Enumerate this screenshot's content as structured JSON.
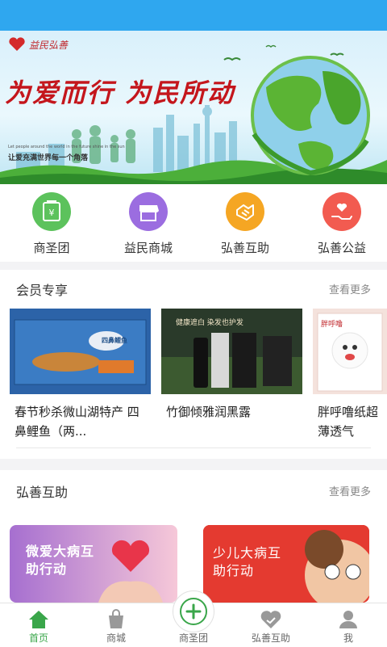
{
  "banner": {
    "logo_text": "益民弘善",
    "slogan": "为爱而行 为民所动",
    "subtitle_en": "Let people around the world in the future shine in the sun",
    "subtitle": "让爱充满世界每一个角落"
  },
  "categories": [
    {
      "label": "商圣团",
      "icon": "money-bag-icon",
      "color": "#5cc25c"
    },
    {
      "label": "益民商城",
      "icon": "store-icon",
      "color": "#9b6de0"
    },
    {
      "label": "弘善互助",
      "icon": "handshake-icon",
      "color": "#f5a623"
    },
    {
      "label": "弘善公益",
      "icon": "heart-hand-icon",
      "color": "#f25b50"
    }
  ],
  "member": {
    "title": "会员专享",
    "more": "查看更多",
    "products": [
      {
        "name": "春节秒杀微山湖特产 四鼻鲤鱼（两...",
        "image_text": "四鼻鲤鱼"
      },
      {
        "name": "竹御倾雅润黑露",
        "image_text": "健康遮白 染发也护发"
      },
      {
        "name": "胖呼噜纸超薄透气",
        "image_text": "胖呼噜"
      }
    ]
  },
  "mutual": {
    "title": "弘善互助",
    "more": "查看更多",
    "cards": [
      {
        "text": "微爱大病互助行动"
      },
      {
        "text": "少儿大病互助行动"
      }
    ]
  },
  "tabbar": {
    "tabs": [
      {
        "label": "首页",
        "icon": "home-icon"
      },
      {
        "label": "商城",
        "icon": "shopping-bag-icon"
      },
      {
        "label": "商圣团",
        "icon": "plus-icon"
      },
      {
        "label": "弘善互助",
        "icon": "heart-icon"
      },
      {
        "label": "我",
        "icon": "user-icon"
      }
    ],
    "active": "首页",
    "accent": "#3aa64a"
  }
}
